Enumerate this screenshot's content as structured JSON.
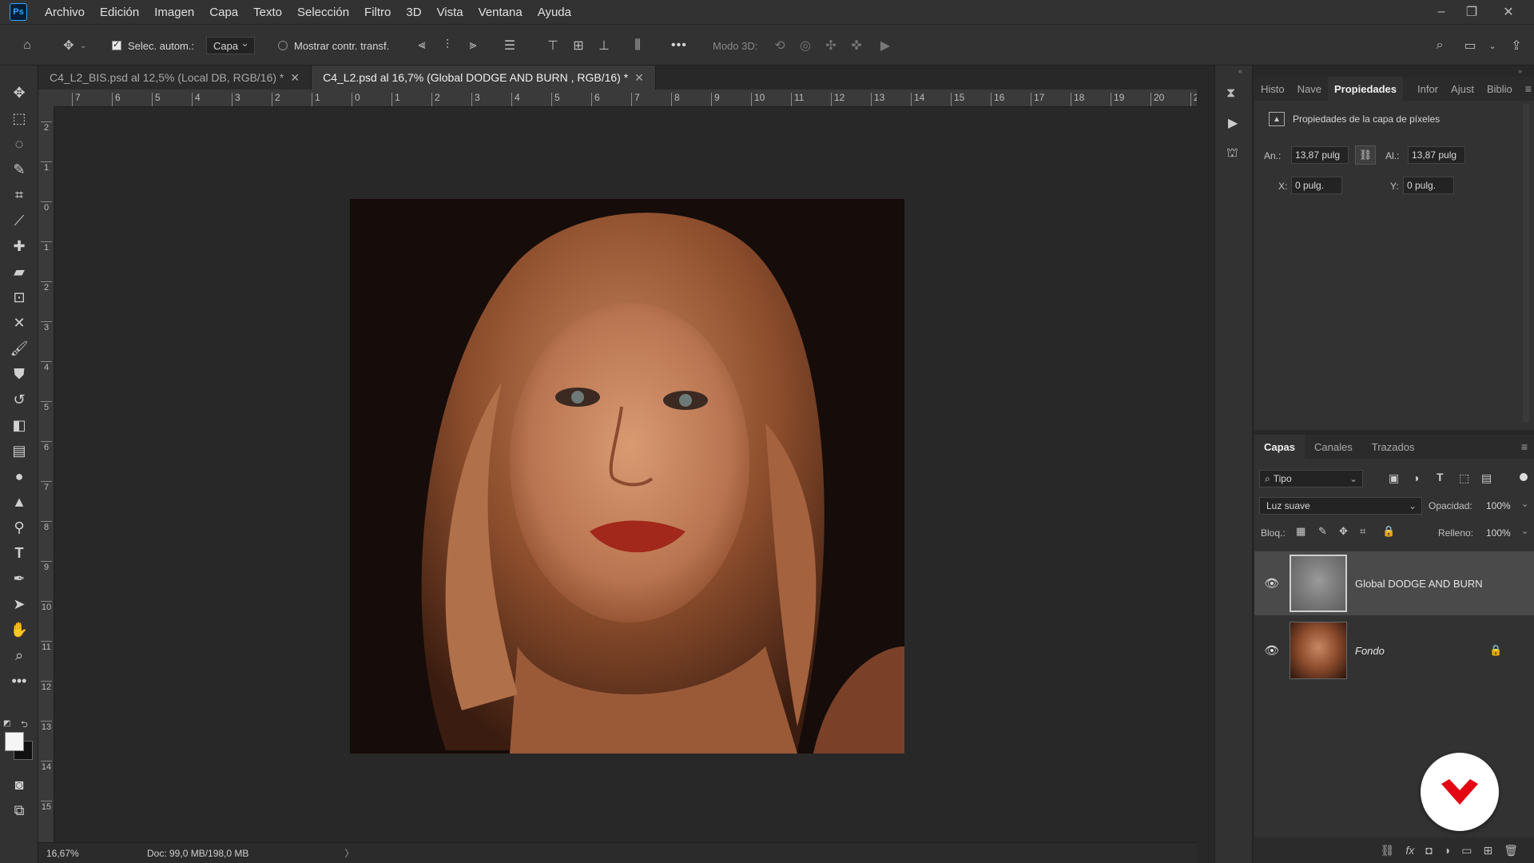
{
  "menubar": {
    "logo": "Ps",
    "items": [
      "Archivo",
      "Edición",
      "Imagen",
      "Capa",
      "Texto",
      "Selección",
      "Filtro",
      "3D",
      "Vista",
      "Ventana",
      "Ayuda"
    ],
    "window_controls": [
      "–",
      "❐",
      "✕"
    ]
  },
  "options": {
    "auto_select_label": "Selec. autom.:",
    "auto_select_checked": true,
    "target_value": "Capa",
    "show_transform_label": "Mostrar contr. transf.",
    "more_label": "•••",
    "mode3d_label": "Modo 3D:"
  },
  "tabs": [
    {
      "label": "C4_L2_BIS.psd al 12,5% (Local DB, RGB/16) *",
      "active": false
    },
    {
      "label": "C4_L2.psd al 16,7% (Global DODGE AND BURN , RGB/16) *",
      "active": true
    }
  ],
  "ruler_h": [
    "7",
    "6",
    "5",
    "4",
    "3",
    "2",
    "1",
    "0",
    "1",
    "2",
    "3",
    "4",
    "5",
    "6",
    "7",
    "8",
    "9",
    "10",
    "11",
    "12",
    "13",
    "14",
    "15",
    "16",
    "17",
    "18",
    "19",
    "20",
    "2"
  ],
  "ruler_v": [
    "2",
    "1",
    "0",
    "1",
    "2",
    "3",
    "4",
    "5",
    "6",
    "7",
    "8",
    "9",
    "10",
    "11",
    "12",
    "13",
    "14",
    "15"
  ],
  "status": {
    "zoom": "16,67%",
    "doc": "Doc: 99,0 MB/198,0 MB",
    "arrow": "〉"
  },
  "properties": {
    "tabs": [
      "Histo",
      "Nave",
      "Propiedades",
      "Infor",
      "Ajust",
      "Biblio"
    ],
    "active_tab": "Propiedades",
    "section_title": "Propiedades de la capa de píxeles",
    "width_label": "An.:",
    "width_value": "13,87 pulg",
    "height_label": "Al.:",
    "height_value": "13,87 pulg",
    "x_label": "X:",
    "x_value": "0 pulg.",
    "y_label": "Y:",
    "y_value": "0 pulg."
  },
  "layers_panel": {
    "tabs": [
      "Capas",
      "Canales",
      "Trazados"
    ],
    "active_tab": "Capas",
    "filter_value": "Tipo",
    "blend_mode": "Luz suave",
    "opacity_label": "Opacidad:",
    "opacity_value": "100%",
    "lock_label": "Bloq.:",
    "fill_label": "Relleno:",
    "fill_value": "100%",
    "layers": [
      {
        "name": "Global DODGE AND BURN",
        "visible": true,
        "selected": true,
        "locked": false
      },
      {
        "name": "Fondo",
        "visible": true,
        "selected": false,
        "locked": true
      }
    ]
  },
  "colors": {
    "accent_blue": "#31a8ff",
    "brand_red": "#e30613"
  }
}
